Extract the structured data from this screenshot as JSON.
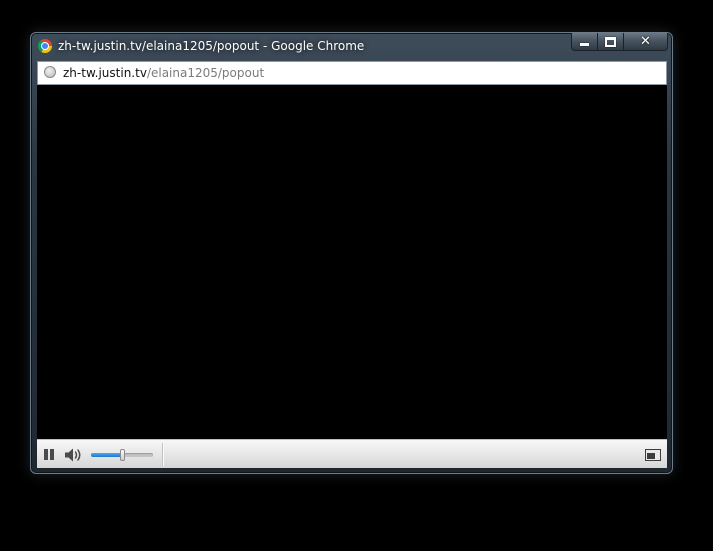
{
  "window": {
    "title": "zh-tw.justin.tv/elaina1205/popout - Google Chrome",
    "controls": {
      "minimize_icon": "minimize-icon",
      "maximize_icon": "maximize-icon",
      "close_icon": "close-icon"
    }
  },
  "address_bar": {
    "host": "zh-tw.justin.tv",
    "path": "/elaina1205/popout",
    "icon": "globe-icon"
  },
  "player": {
    "pause_icon": "pause-icon",
    "volume_icon": "speaker-icon",
    "volume_level": 0.5,
    "popout_icon": "popout-icon"
  },
  "colors": {
    "slider_fill": "#2a86dc",
    "video_background": "#000000"
  }
}
